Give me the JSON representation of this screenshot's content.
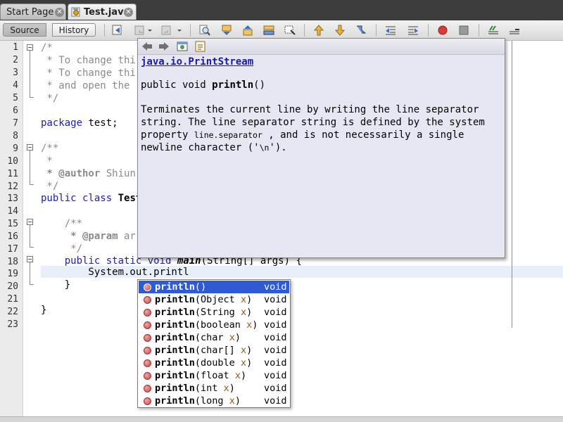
{
  "tabs": [
    {
      "label": "Start Page",
      "close_glyph": "✕",
      "active": false
    },
    {
      "label": "Test.java",
      "close_glyph": "✕",
      "active": true
    }
  ],
  "toolbar": {
    "source_label": "Source",
    "history_label": "History",
    "icons": [
      "last-edit-icon",
      "back-icon",
      "forward-icon",
      "find-icon",
      "find-previous-icon",
      "find-next-icon",
      "find-selection-icon",
      "toggle-highlight-icon",
      "previous-bookmark-icon",
      "next-bookmark-icon",
      "toggle-bookmark-icon",
      "shift-left-icon",
      "shift-right-icon",
      "start-macro-icon",
      "stop-macro-icon",
      "comment-icon",
      "uncomment-icon"
    ]
  },
  "editor": {
    "line_numbers": [
      "1",
      "2",
      "3",
      "4",
      "5",
      "6",
      "7",
      "8",
      "9",
      "10",
      "11",
      "12",
      "13",
      "14",
      "15",
      "16",
      "17",
      "18",
      "19",
      "20",
      "21",
      "22",
      "23"
    ],
    "current_line": 19,
    "lines": {
      "l1": "/*",
      "l2": " * To change thi",
      "l3": " * To change thi",
      "l4": " * and open the",
      "l5": " */",
      "l7_kw": "package",
      "l7_rest": " test;",
      "l9": "/**",
      "l10": " *",
      "l11_tag": " * @author",
      "l11_rest": " Shiun",
      "l12": " */",
      "l13_kw": "public class",
      "l13_name": " Test",
      "l15": "    /**",
      "l16_tag": "     * @param",
      "l16_rest": " ar",
      "l17": "     */",
      "l18_kw": "    public static void",
      "l18_name": " main",
      "l18_rest": "(String[] args) {",
      "l19": "        System.out.printl",
      "l20": "    }",
      "l22": "}"
    }
  },
  "javadoc": {
    "nav_icons": [
      "back-icon",
      "forward-icon",
      "show-in-browser-icon",
      "open-source-icon"
    ],
    "class_link": "java.io.PrintStream",
    "signature_prefix": "public void ",
    "signature_method": "println",
    "signature_suffix": "()",
    "desc_part1": "Terminates the current line by writing the line separator string. The line separator string is defined by the system property ",
    "desc_code": "line.separator",
    "desc_part2": " , and is not necessarily a single newline character ('",
    "desc_code2": "\\n",
    "desc_part3": "')."
  },
  "completion": {
    "items": [
      {
        "method": "println",
        "open": "(",
        "ptype": "",
        "pname": "",
        "close": ")",
        "ret": "void",
        "selected": true
      },
      {
        "method": "println",
        "open": "(Object ",
        "ptype": "Object",
        "pname": "x",
        "close": ")",
        "ret": "void"
      },
      {
        "method": "println",
        "open": "(String ",
        "ptype": "String",
        "pname": "x",
        "close": ")",
        "ret": "void"
      },
      {
        "method": "println",
        "open": "(boolean ",
        "ptype": "boolean",
        "pname": "x",
        "close": ")",
        "ret": "void"
      },
      {
        "method": "println",
        "open": "(char ",
        "ptype": "char",
        "pname": "x",
        "close": ")",
        "ret": "void"
      },
      {
        "method": "println",
        "open": "(char[] ",
        "ptype": "char[]",
        "pname": "x",
        "close": ")",
        "ret": "void"
      },
      {
        "method": "println",
        "open": "(double ",
        "ptype": "double",
        "pname": "x",
        "close": ")",
        "ret": "void"
      },
      {
        "method": "println",
        "open": "(float ",
        "ptype": "float",
        "pname": "x",
        "close": ")",
        "ret": "void"
      },
      {
        "method": "println",
        "open": "(int ",
        "ptype": "int",
        "pname": "x",
        "close": ")",
        "ret": "void"
      },
      {
        "method": "println",
        "open": "(long ",
        "ptype": "long",
        "pname": "x",
        "close": ")",
        "ret": "void"
      }
    ]
  },
  "colors": {
    "selection": "#2f5bd2",
    "current_line": "#e9eff8",
    "margin_line": "#e06b6b",
    "keyword": "#1f1fa8",
    "comment": "#8a8a8a"
  }
}
